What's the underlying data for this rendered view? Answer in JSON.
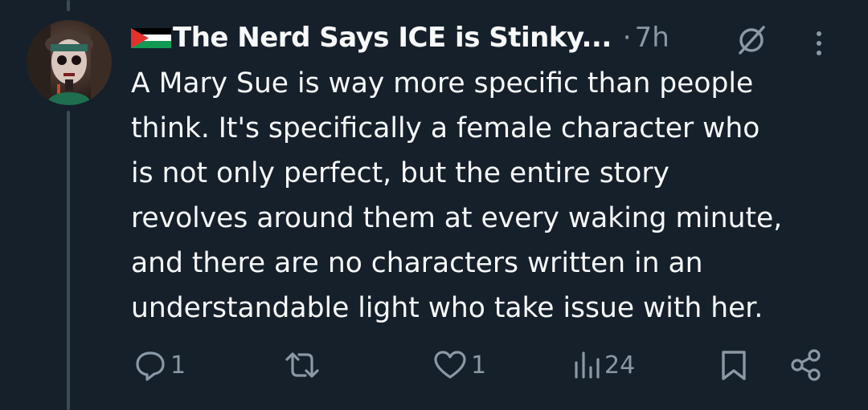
{
  "tweet": {
    "display_name": "The Nerd Says ICE is Stinky...",
    "separator": "·",
    "time": "7h",
    "body_lines": [
      "A Mary Sue is way more specific than people",
      "think. It's specifically a female character who",
      "is not only perfect, but the entire story",
      "revolves around them at every waking minute,",
      "and there are no characters written in an",
      "understandable light who take issue with her."
    ]
  },
  "actions": {
    "reply_count": "1",
    "like_count": "1",
    "views_count": "24"
  },
  "icons": {
    "flag": "palestine-flag-icon",
    "grok": "grok-icon",
    "more": "more-vertical-icon",
    "reply": "reply-icon",
    "retweet": "retweet-icon",
    "like": "heart-icon",
    "views": "views-icon",
    "bookmark": "bookmark-icon",
    "share": "share-icon"
  },
  "colors": {
    "background": "#15202b",
    "text": "#f7f9f9",
    "muted": "#8b98a5",
    "thread_line": "#3e4a56",
    "flag_red": "#e4312b",
    "flag_green": "#149954"
  }
}
